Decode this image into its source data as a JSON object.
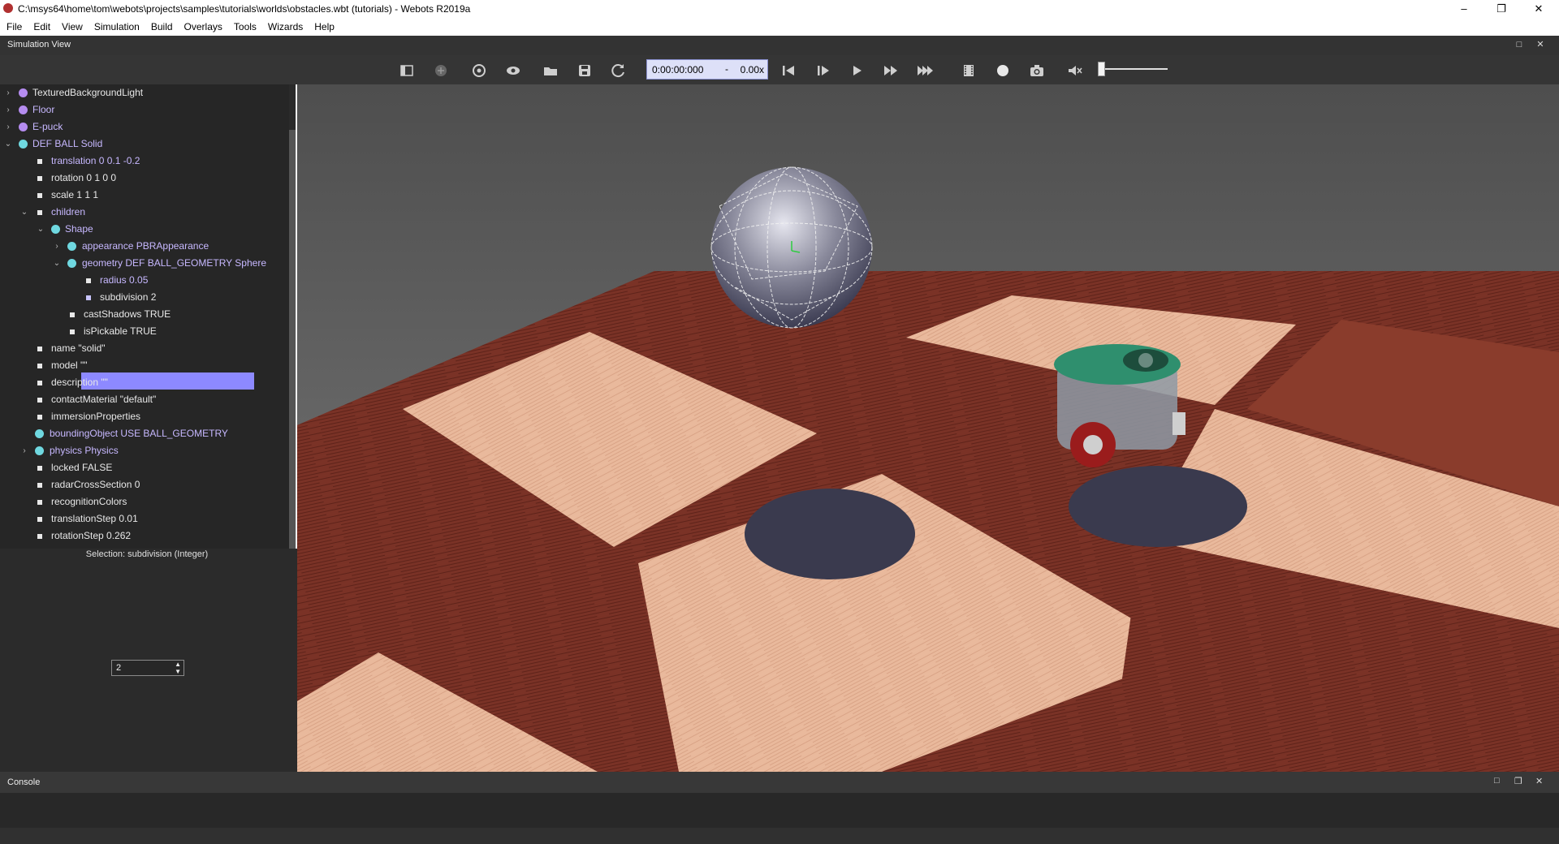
{
  "window": {
    "title": "C:\\msys64\\home\\tom\\webots\\projects\\samples\\tutorials\\worlds\\obstacles.wbt (tutorials) - Webots R2019a",
    "minimize": "–",
    "maximize": "❐",
    "close": "✕"
  },
  "menu": [
    "File",
    "Edit",
    "View",
    "Simulation",
    "Build",
    "Overlays",
    "Tools",
    "Wizards",
    "Help"
  ],
  "sim_view": {
    "label": "Simulation View",
    "time": "0:00:00:000",
    "separator": "-",
    "speed": "0.00x"
  },
  "scene_tree": {
    "nodes": [
      {
        "label": "TexturedBackgroundLight",
        "arrow": "›"
      },
      {
        "label": "Floor",
        "arrow": "›"
      },
      {
        "label": "E-puck",
        "arrow": "›"
      },
      {
        "label": "DEF BALL Solid",
        "arrow": "⌄"
      },
      {
        "label": "translation 0 0.1 -0.2"
      },
      {
        "label": "rotation 0 1 0 0"
      },
      {
        "label": "scale 1 1 1"
      },
      {
        "label": "children",
        "arrow": "⌄"
      },
      {
        "label": "Shape",
        "arrow": "⌄"
      },
      {
        "label": "appearance PBRAppearance",
        "arrow": "›"
      },
      {
        "label": "geometry DEF BALL_GEOMETRY Sphere",
        "arrow": "⌄"
      },
      {
        "label": "radius 0.05"
      },
      {
        "label": "subdivision 2"
      },
      {
        "label": "castShadows TRUE"
      },
      {
        "label": "isPickable TRUE"
      },
      {
        "label": "name \"solid\""
      },
      {
        "label": "model \"\""
      },
      {
        "label": "description \"\""
      },
      {
        "label": "contactMaterial \"default\""
      },
      {
        "label": "immersionProperties"
      },
      {
        "label": "boundingObject USE BALL_GEOMETRY"
      },
      {
        "label": "physics Physics",
        "arrow": "›"
      },
      {
        "label": "locked FALSE"
      },
      {
        "label": "radarCrossSection 0"
      },
      {
        "label": "recognitionColors"
      },
      {
        "label": "translationStep 0.01"
      },
      {
        "label": "rotationStep 0.262"
      }
    ]
  },
  "field_editor": {
    "selection": "Selection: subdivision (Integer)",
    "value": "2",
    "spin_up": "▲",
    "spin_down": "▼"
  },
  "console": {
    "label": "Console"
  },
  "icons": {
    "toolbar": [
      "hide-scene-tree-icon",
      "add-node-icon",
      "reload-icon",
      "view-icon",
      "open-world-icon",
      "save-world-icon",
      "reset-simulation-icon",
      "step-back-icon",
      "step-icon",
      "play-icon",
      "fast-icon",
      "fastest-icon",
      "record-movie-icon",
      "record-animation-icon",
      "screenshot-icon",
      "mute-icon"
    ]
  }
}
